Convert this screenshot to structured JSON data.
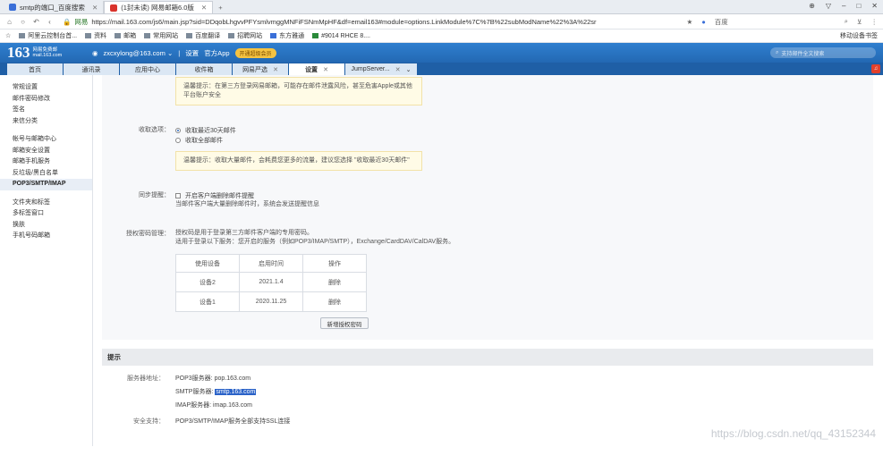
{
  "browser": {
    "tabs": [
      {
        "label": "smtp的端口_百度搜索",
        "active": false
      },
      {
        "label": "(1封未读) 网易邮箱6.0版",
        "active": true
      }
    ],
    "new_tab": "+",
    "url_prefix": "网易",
    "url": "https://mail.163.com/js6/main.jsp?sid=DDqobLhgvvPFYsmlvmggMNFiFSNmMpHF&df=email163#module=options.LinkModule%7C%7B%22subModName%22%3A%22sr",
    "search_engine": "百度",
    "bookmarks": [
      "阿里云控制台首...",
      "资料",
      "邮箱",
      "常用网站",
      "百度翻译",
      "招聘网站",
      "东方雅通",
      "#9014 RHCE 8...."
    ],
    "mobile_bookmarks": "移动设备书签"
  },
  "mail": {
    "logo_number": "163",
    "logo_line1": "网易免费邮",
    "logo_line2": "mail.163.com",
    "account": "zxcxylong@163.com ⌄",
    "settings": "设置",
    "app": "官方App",
    "vip": "开通超级会员",
    "search_placeholder": "支持邮件全文搜索",
    "tabs": [
      {
        "label": "首页",
        "active": false,
        "closable": false
      },
      {
        "label": "通讯录",
        "active": false,
        "closable": false
      },
      {
        "label": "应用中心",
        "active": false,
        "closable": false
      },
      {
        "label": "收件箱",
        "active": false,
        "closable": false
      },
      {
        "label": "网易严选",
        "active": false,
        "closable": true
      },
      {
        "label": "设置",
        "active": true,
        "closable": true
      },
      {
        "label": "JumpServer...",
        "active": false,
        "closable": true
      }
    ]
  },
  "sidebar": {
    "groups": [
      [
        "常规设置",
        "邮件密码修改",
        "签名",
        "来信分类"
      ],
      [
        "帐号与邮箱中心",
        "邮箱安全设置",
        "邮箱手机服务",
        "反垃圾/黑白名单",
        "POP3/SMTP/IMAP"
      ],
      [
        "文件夹和标签",
        "多标签窗口",
        "换肤",
        "手机号码邮箱"
      ]
    ],
    "active": "POP3/SMTP/IMAP"
  },
  "content": {
    "tip1_line1": "温馨提示：在第三方登录网易邮箱，可能存在邮件泄露风险，甚至危害Apple或其他",
    "tip1_line2": "平台账户安全",
    "receive_label": "收取选项：",
    "receive_opt1": "收取最近30天邮件",
    "receive_opt2": "收取全部邮件",
    "tip2": "温馨提示：收取大量邮件，会耗费您更多的流量，建议您选择 \"收取最近30天邮件\"",
    "sync_label": "同步提醒：",
    "sync_opt": "开启客户端删除邮件提醒",
    "sync_note": "当邮件客户端大量删除邮件时，系统会发送提醒信息",
    "auth_label": "授权密码管理：",
    "auth_note1": "授权码是用于登录第三方邮件客户端的专用密码。",
    "auth_note2": "适用于登录以下服务：您开启的服务（例如POP3/IMAP/SMTP），Exchange/CardDAV/CalDAV服务。",
    "table_headers": [
      "使用设备",
      "启用时间",
      "操作"
    ],
    "table_rows": [
      [
        "设备2",
        "2021.1.4",
        "删除"
      ],
      [
        "设备1",
        "2020.11.25",
        "删除"
      ]
    ],
    "new_code_button": "新增授权密码",
    "section_title": "提示",
    "server_label": "服务器地址：",
    "pop3": "POP3服务器: pop.163.com",
    "smtp_prefix": "SMTP服务器: ",
    "smtp_host": "smtp.163.com",
    "imap": "IMAP服务器: imap.163.com",
    "security_label": "安全支持：",
    "security_value": "POP3/SMTP/IMAP服务全部支持SSL连接"
  },
  "watermark": "https://blog.csdn.net/qq_43152344"
}
